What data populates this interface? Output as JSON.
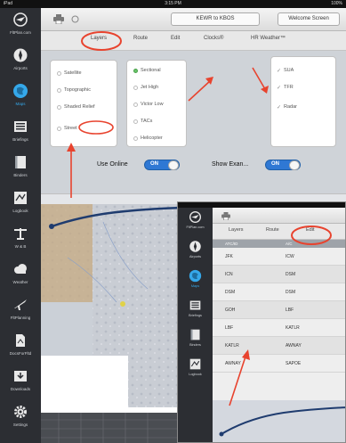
{
  "status_bar": {
    "left": "iPad",
    "center": "3:15 PM",
    "right": "100%"
  },
  "sidebar": {
    "items": [
      {
        "label": "FltPlan.com",
        "icon": "airplane-globe-icon"
      },
      {
        "label": "Airports",
        "icon": "compass-icon"
      },
      {
        "label": "Maps",
        "icon": "globe-icon"
      },
      {
        "label": "Briefings",
        "icon": "briefing-icon"
      },
      {
        "label": "Binders",
        "icon": "binder-icon"
      },
      {
        "label": "Logbook",
        "icon": "logbook-icon"
      },
      {
        "label": "W & B",
        "icon": "balance-icon"
      },
      {
        "label": "Weather",
        "icon": "cloud-icon"
      },
      {
        "label": "FltPlanning",
        "icon": "plane-icon"
      },
      {
        "label": "DocsForFltd",
        "icon": "document-icon"
      },
      {
        "label": "Downloads",
        "icon": "download-icon"
      },
      {
        "label": "Settings",
        "icon": "gear-icon"
      }
    ]
  },
  "toolbar": {
    "route_label": "KEWR to KBOS",
    "welcome_label": "Welcome Screen"
  },
  "tabs": [
    "Layers",
    "Route",
    "Edit",
    "Clocks®",
    "HR Weather™"
  ],
  "base_layers": [
    "Satellite",
    "Topographic",
    "Shaded Relief",
    "Street"
  ],
  "charts": [
    "Sectional",
    "Jet High",
    "Victor Low",
    "TACs",
    "Helicopter"
  ],
  "overlays": [
    "SUA",
    "TFR",
    "Radar"
  ],
  "toggles": {
    "use_online_label": "Use Online",
    "use_online_value": "ON",
    "show_label": "Show Exan...",
    "show_value": "ON"
  },
  "inset": {
    "sidebar": [
      "FltPlan.com",
      "Airports",
      "Maps",
      "Briefings",
      "Binders",
      "Logbook"
    ],
    "tabs": [
      "Layers",
      "Route",
      "Edit"
    ],
    "table_header": [
      "ATC/ID",
      "A/C"
    ],
    "rows": [
      [
        "JFK",
        "ICW"
      ],
      [
        "ICN",
        "DSM"
      ],
      [
        "DSM",
        "DSM"
      ],
      [
        "GOH",
        "LBF"
      ],
      [
        "LBF",
        "KATLR"
      ],
      [
        "KATLR",
        "AWNAY"
      ],
      [
        "AWNAY",
        "SAPOE"
      ]
    ]
  },
  "colors": {
    "sidebar_bg": "#2c2e33",
    "accent": "#35a8ea",
    "annotation": "#e8432e",
    "toggle_on": "#2f78d4"
  }
}
